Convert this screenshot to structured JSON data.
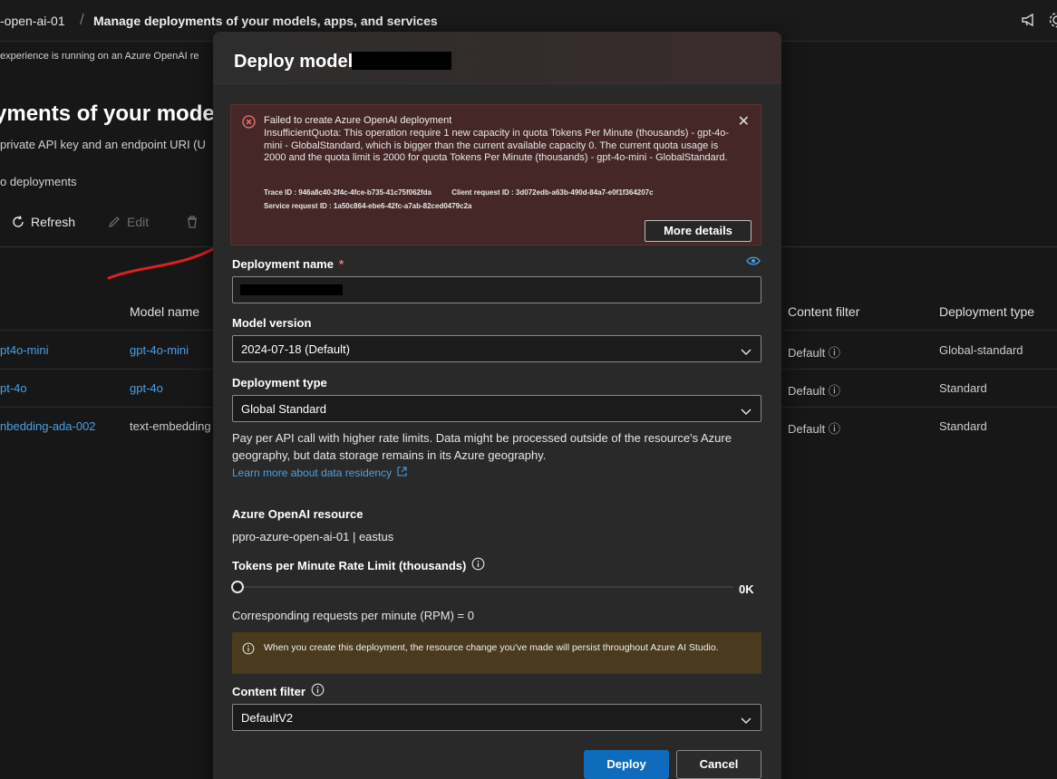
{
  "topbar": {
    "crumb_resource": "-open-ai-01",
    "crumb_separator": "/",
    "crumb_page": "Manage deployments of your models, apps, and services"
  },
  "background": {
    "notice": "experience is running on an Azure OpenAI re",
    "heading": "yments of your models",
    "subtitle": "private API key and an endpoint URI (U",
    "deployments_label": "o deployments",
    "commands": {
      "refresh": "Refresh",
      "edit": "Edit"
    },
    "table": {
      "headers": {
        "model_name": "Model name",
        "content_filter": "Content filter",
        "deployment_type": "Deployment type"
      },
      "rows": [
        {
          "name": "pt4o-mini",
          "model": "gpt-4o-mini",
          "filter": "Default",
          "type": "Global-standard"
        },
        {
          "name": "pt-4o",
          "model": "gpt-4o",
          "filter": "Default",
          "type": "Standard"
        },
        {
          "name": "nbedding-ada-002",
          "model": "text-embedding",
          "filter": "Default",
          "type": "Standard"
        }
      ]
    }
  },
  "modal": {
    "title": "Deploy model",
    "error": {
      "title": "Failed to create Azure OpenAI deployment",
      "body": "InsufficientQuota: This operation require 1 new capacity in quota Tokens Per Minute (thousands) - gpt-4o-mini - GlobalStandard, which is bigger than the current available capacity 0. The current quota usage is 2000 and the quota limit is 2000 for quota Tokens Per Minute (thousands) - gpt-4o-mini - GlobalStandard.",
      "trace": "Trace ID : 946a8c40-2f4c-4fce-b735-41c75f062fda",
      "client_request": "Client request ID : 3d072edb-a63b-490d-84a7-e0f1f364207c",
      "service_request": "Service request ID : 1a50c864-ebe6-42fc-a7ab-82ced0479c2a",
      "more_details": "More details"
    },
    "deployment_name": {
      "label": "Deployment name",
      "required": "*"
    },
    "model_version": {
      "label": "Model version",
      "value": "2024-07-18 (Default)"
    },
    "deployment_type": {
      "label": "Deployment type",
      "value": "Global Standard",
      "help": "Pay per API call with higher rate limits. Data might be processed outside of the resource's Azure geography, but data storage remains in its Azure geography.",
      "learn_more": "Learn more about data residency"
    },
    "resource": {
      "label": "Azure OpenAI resource",
      "value": "ppro-azure-open-ai-01 | eastus"
    },
    "rate_limit": {
      "label": "Tokens per Minute Rate Limit (thousands)",
      "value": "0K",
      "fraction": 0
    },
    "rpm": "Corresponding requests per minute (RPM) = 0",
    "warning": "When you create this deployment, the resource change you've made will persist throughout Azure AI Studio.",
    "content_filter": {
      "label": "Content filter",
      "value": "DefaultV2"
    },
    "buttons": {
      "deploy": "Deploy",
      "cancel": "Cancel"
    }
  },
  "colors": {
    "accent": "#0f6cbd",
    "link": "#4aa0e6",
    "error_bg": "#442726",
    "warning_bg": "#4a3b1e",
    "annotation": "#e02020"
  }
}
